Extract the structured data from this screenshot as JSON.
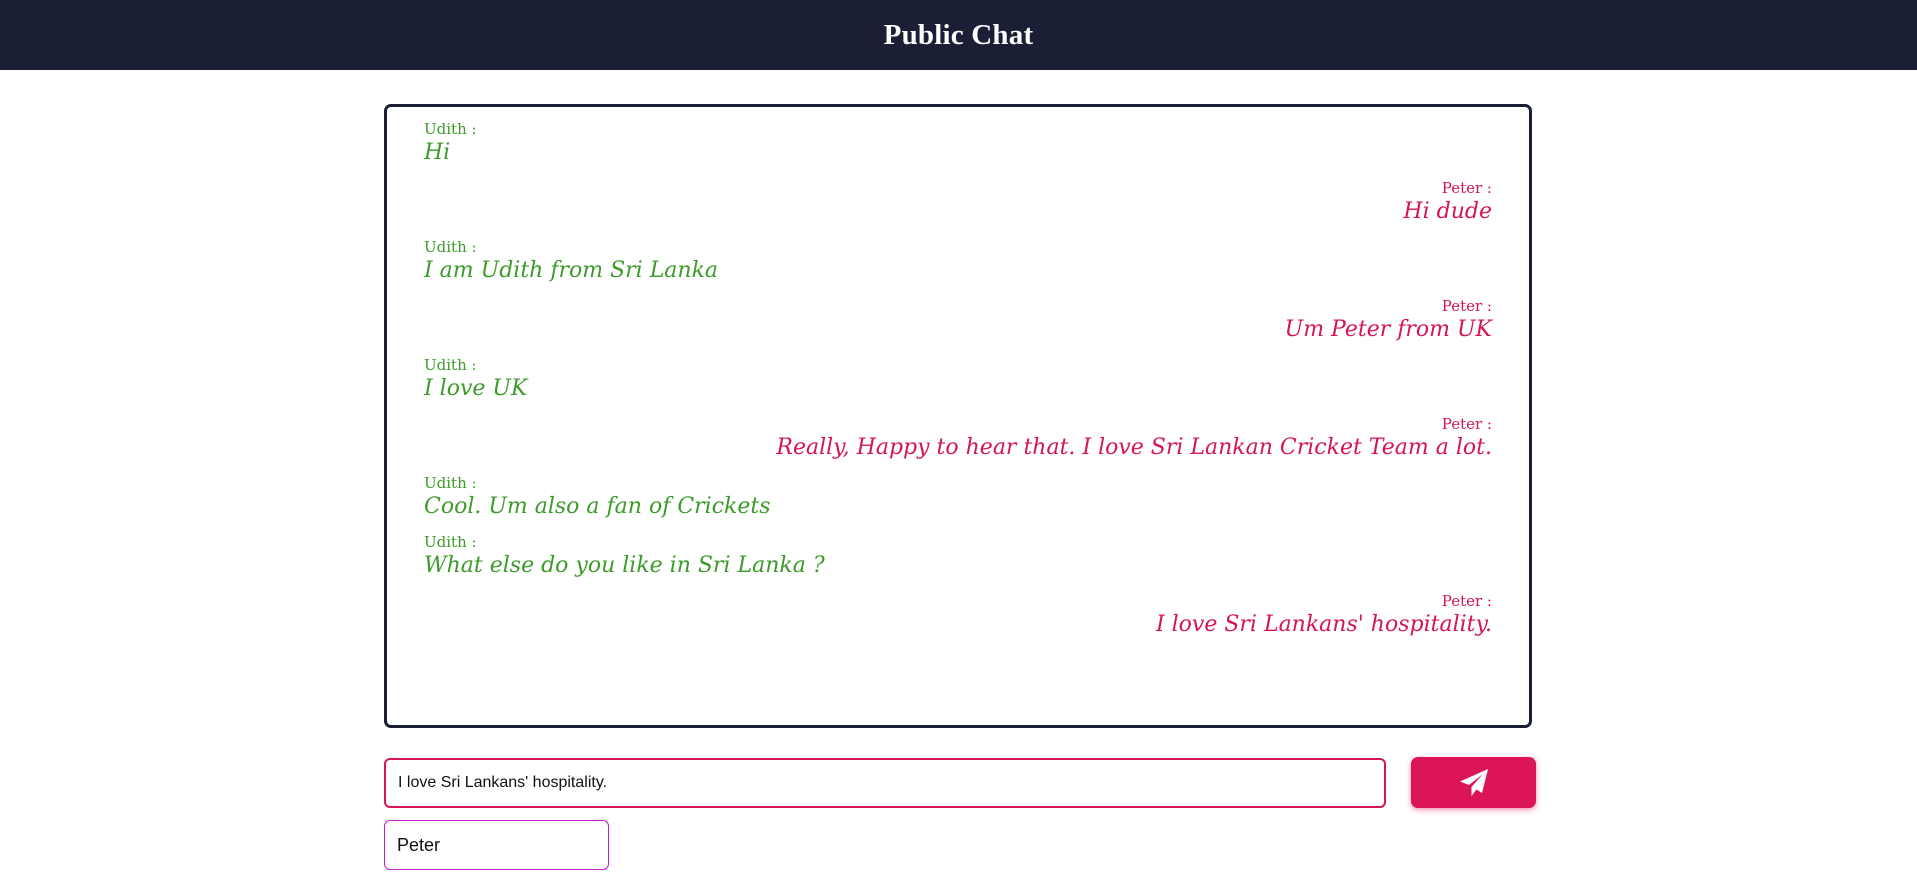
{
  "header": {
    "title": "Public Chat"
  },
  "colors": {
    "header_bg": "#1a1f35",
    "left_user": "#3c9b2a",
    "right_user": "#d41556",
    "send_button": "#dc1557",
    "name_border": "#c21fc9"
  },
  "chat": {
    "messages": [
      {
        "side": "left",
        "sender": "Udith :",
        "text": "Hi"
      },
      {
        "side": "right",
        "sender": "Peter :",
        "text": "Hi dude"
      },
      {
        "side": "left",
        "sender": "Udith :",
        "text": "I am Udith from Sri Lanka"
      },
      {
        "side": "right",
        "sender": "Peter :",
        "text": "Um Peter from UK"
      },
      {
        "side": "left",
        "sender": "Udith :",
        "text": "I love UK"
      },
      {
        "side": "right",
        "sender": "Peter :",
        "text": "Really, Happy to hear that. I love Sri Lankan Cricket Team a lot."
      },
      {
        "side": "left",
        "sender": "Udith :",
        "text": "Cool. Um also a fan of Crickets"
      },
      {
        "side": "left",
        "sender": "Udith :",
        "text": "What else do you like in Sri Lanka ?"
      },
      {
        "side": "right",
        "sender": "Peter :",
        "text": "I love Sri Lankans' hospitality."
      }
    ]
  },
  "composer": {
    "message_value": "I love Sri Lankans' hospitality.",
    "send_icon": "paper-plane-icon",
    "name_value": "Peter"
  }
}
